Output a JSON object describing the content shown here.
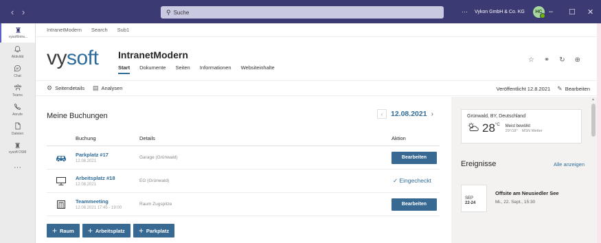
{
  "titlebar": {
    "nav_back": "‹",
    "nav_forward": "›",
    "search_placeholder": "Suche",
    "more": "···",
    "org": "Vykon GmbH & Co. KG",
    "avatar_initials": "HC",
    "minimize": "–",
    "maximize": "☐",
    "close": "✕"
  },
  "rail": {
    "items": [
      {
        "label": "vysoftIntra...",
        "icon": "vysoft-app-icon",
        "glyph": "♜"
      },
      {
        "label": "Aktivität",
        "icon": "bell-icon",
        "glyph": "🔔︎"
      },
      {
        "label": "Chat",
        "icon": "chat-icon",
        "glyph": "◯"
      },
      {
        "label": "Teams",
        "icon": "teams-icon",
        "glyph": "⚇"
      },
      {
        "label": "Anrufe",
        "icon": "phone-icon",
        "glyph": "✆"
      },
      {
        "label": "Dateien",
        "icon": "file-icon",
        "glyph": "▯"
      },
      {
        "label": "vysoft DSM",
        "icon": "vysoft-dsm-icon",
        "glyph": "♜"
      },
      {
        "label": "",
        "icon": "more-icon",
        "glyph": "···"
      }
    ]
  },
  "tabs": [
    "IntranetModern",
    "Search",
    "Sub1"
  ],
  "site": {
    "logo_vy": "vy",
    "logo_soft": "soft",
    "title": "IntranetModern",
    "nav": [
      "Start",
      "Dokumente",
      "Seiten",
      "Informationen",
      "Websiteinhalte"
    ],
    "active_nav": "Start"
  },
  "cmdbar": {
    "details": "Seitendetails",
    "analytics": "Analysen",
    "published": "Veröffentlicht 12.8.2021",
    "edit": "Bearbeiten"
  },
  "bookings": {
    "heading": "Meine Buchungen",
    "date": "12.08.2021",
    "columns": {
      "booking": "Buchung",
      "details": "Details",
      "action": "Aktion"
    },
    "rows": [
      {
        "icon": "car-icon",
        "title": "Parkplatz #17",
        "date": "12.08.2021",
        "details": "Garage (Grünwald)",
        "action": "Bearbeiten",
        "action_type": "button"
      },
      {
        "icon": "desktop-icon",
        "title": "Arbeitsplatz #18",
        "date": "12.08.2021",
        "details": "EG (Grünwald)",
        "action": "Eingecheckt",
        "action_type": "status"
      },
      {
        "icon": "meeting-room-icon",
        "title": "Teammeeting",
        "date": "12.08.2021 17:45 - 19:00",
        "details": "Raum Zugspitze",
        "action": "Bearbeiten",
        "action_type": "button"
      }
    ],
    "add_buttons": [
      "Raum",
      "Arbeitsplatz",
      "Parkplatz"
    ]
  },
  "weather": {
    "location": "Grünwald, BY, Deutschland",
    "temp": "28",
    "unit": "°C",
    "condition": "Meist bewölkt",
    "range": "29°/18°",
    "source": "MSN Wetter"
  },
  "events": {
    "heading": "Ereignisse",
    "show_all": "Alle anzeigen",
    "items": [
      {
        "month": "SEP",
        "range": "22-24",
        "title": "Offsite am Neusiedler See",
        "when": "Mi., 22. Sept., 15:30"
      }
    ]
  },
  "colors": {
    "titlebar": "#3b3a73",
    "accent": "#2f6c99",
    "button": "#386993"
  }
}
